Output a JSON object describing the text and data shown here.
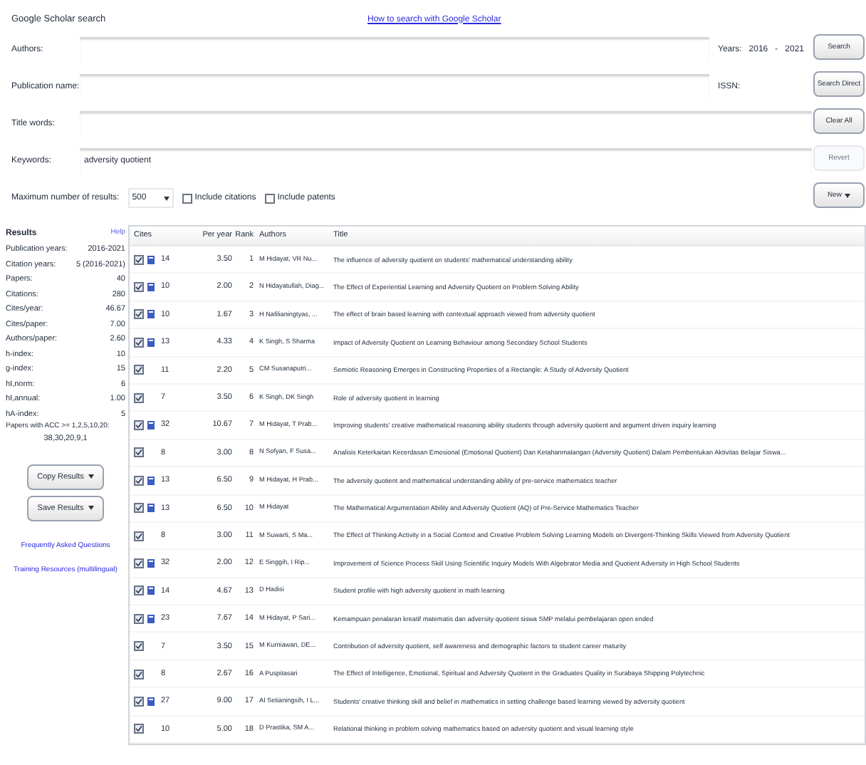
{
  "search": {
    "title": "Google Scholar search",
    "help_link": "How to search with Google Scholar",
    "fields": [
      {
        "label": "Authors:"
      },
      {
        "label": "Publication name:"
      },
      {
        "label": "Title words:"
      },
      {
        "label": "Keywords:",
        "value": "adversity quotient"
      }
    ],
    "years_label": "Years:",
    "year_from": "2016",
    "year_sep": "-",
    "year_to": "2021",
    "issn_label": "ISSN:",
    "max_results_label": "Maximum number of results:",
    "max_results": "500",
    "options": [
      {
        "label": "Include citations",
        "checked": false
      },
      {
        "label": "Include patents",
        "checked": false
      }
    ],
    "buttons": [
      {
        "label": "Search",
        "disabled": false
      },
      {
        "label": "Search Direct",
        "disabled": false
      },
      {
        "label": "Clear All",
        "disabled": false
      },
      {
        "label": "Revert",
        "disabled": true
      },
      {
        "label": "New",
        "disabled": false
      }
    ]
  },
  "results": {
    "title": "Results",
    "help": "Help",
    "metrics": [
      {
        "label": "Publication years:",
        "value": "2016-2021"
      },
      {
        "label": "Citation years:",
        "value": "5 (2016-2021)"
      },
      {
        "label": "Papers:",
        "value": "40"
      },
      {
        "label": "Citations:",
        "value": "280"
      },
      {
        "label": "Cites/year:",
        "value": "46.67"
      },
      {
        "label": "Cites/paper:",
        "value": "7.00"
      },
      {
        "label": "Authors/paper:",
        "value": "2.60"
      },
      {
        "label": "h-index:",
        "value": "10"
      },
      {
        "label": "g-index:",
        "value": "15"
      },
      {
        "label": "hI,norm:",
        "value": "6"
      },
      {
        "label": "hI,annual:",
        "value": "1.00"
      },
      {
        "label": "hA-index:",
        "value": "5"
      }
    ],
    "acc_label": "Papers with ACC >= 1,2,5,10,20:",
    "acc_value": "38,30,20,9,1",
    "actions": [
      "Copy Results",
      "Save Results"
    ],
    "links": [
      "Frequently Asked Questions",
      "Training Resources (multilingual)"
    ]
  },
  "table": {
    "columns": [
      "Cites",
      "Per year",
      "Rank",
      "Authors",
      "Title"
    ],
    "rows": [
      {
        "checked": true,
        "h_core": true,
        "cites": "14",
        "per_year": "3.50",
        "rank": "1",
        "authors": "M Hidayat, VR Nu...",
        "title": "The influence of adversity quotient on students' mathematical understanding ability"
      },
      {
        "checked": true,
        "h_core": true,
        "cites": "10",
        "per_year": "2.00",
        "rank": "2",
        "authors": "N Hidayatullah, Diag...",
        "title": "The Effect of Experiential Learning and Adversity Quotient on Problem Solving Ability"
      },
      {
        "checked": true,
        "h_core": true,
        "cites": "10",
        "per_year": "1.67",
        "rank": "3",
        "authors": "H Nafilianingtyas, ...",
        "title": "The effect of brain based learning with contextual approach viewed from adversity quotient"
      },
      {
        "checked": true,
        "h_core": true,
        "cites": "13",
        "per_year": "4.33",
        "rank": "4",
        "authors": "K Singh, S Sharma",
        "title": "Impact of Adversity Quotient on Learning Behaviour among Secondary School Students"
      },
      {
        "checked": true,
        "h_core": false,
        "cites": "11",
        "per_year": "2.20",
        "rank": "5",
        "authors": "CM Susanaputri...",
        "title": "Semiotic Reasoning Emerges in Constructing Properties of a Rectangle: A Study of Adversity Quotient"
      },
      {
        "checked": true,
        "h_core": false,
        "cites": "7",
        "per_year": "3.50",
        "rank": "6",
        "authors": "K Singh, DK Singh",
        "title": "Role of adversity quotient in learning"
      },
      {
        "checked": true,
        "h_core": true,
        "cites": "32",
        "per_year": "10.67",
        "rank": "7",
        "authors": "M Hidayat, T Prab...",
        "title": "Improving students' creative mathematical reasoning ability students through adversity quotient and argument driven inquiry learning"
      },
      {
        "checked": true,
        "h_core": false,
        "cites": "8",
        "per_year": "3.00",
        "rank": "8",
        "authors": "N Sofyan, F Susa...",
        "title": "Analisis Keterkaitan Kecerdasan Emosional (Emotional Quotient) Dan Ketahanmalangan (Adversity Quotient) Dalam Pembentukan Aktivitas Belajar Siswa..."
      },
      {
        "checked": true,
        "h_core": true,
        "cites": "13",
        "per_year": "6.50",
        "rank": "9",
        "authors": "M Hidayat, H Prab...",
        "title": "The adversity quotient and mathematical understanding ability of pre-service mathematics teacher"
      },
      {
        "checked": true,
        "h_core": true,
        "cites": "13",
        "per_year": "6.50",
        "rank": "10",
        "authors": "M Hidayat",
        "title": "The Mathematical Argumentation Ability and Adversity Quotient (AQ) of Pre-Service Mathematics Teacher"
      },
      {
        "checked": true,
        "h_core": false,
        "cites": "8",
        "per_year": "3.00",
        "rank": "11",
        "authors": "M Suwarti, S Ma...",
        "title": "The Effect of Thinking Activity in a Social Context and Creative Problem Solving Learning Models on Divergent-Thinking Skills Viewed from Adversity Quotient"
      },
      {
        "checked": true,
        "h_core": true,
        "cites": "32",
        "per_year": "2.00",
        "rank": "12",
        "authors": "E Singgih, I Rip...",
        "title": "Improvement of Science Process Skill Using Scientific Inquiry Models With Algebrator Media and Quotient Adversity in High School Students"
      },
      {
        "checked": true,
        "h_core": true,
        "cites": "14",
        "per_year": "4.67",
        "rank": "13",
        "authors": "D Hadisi",
        "title": "Student profile with high adversity quotient in math learning"
      },
      {
        "checked": true,
        "h_core": true,
        "cites": "23",
        "per_year": "7.67",
        "rank": "14",
        "authors": "M Hidayat, P Sari...",
        "title": "Kemampuan penalaran kreatif matematis dan adversity quotient siswa SMP melalui pembelajaran open ended"
      },
      {
        "checked": true,
        "h_core": false,
        "cites": "7",
        "per_year": "3.50",
        "rank": "15",
        "authors": "M Kurniawan, DE...",
        "title": "Contribution of adversity quotient, self awareness and demographic factors to student career maturity"
      },
      {
        "checked": true,
        "h_core": false,
        "cites": "8",
        "per_year": "2.67",
        "rank": "16",
        "authors": "A Puspitasari",
        "title": "The Effect of Intelligence, Emotional, Spiritual and Adversity Quotient in the Graduates Quality in Surabaya Shipping Polytechnic"
      },
      {
        "checked": true,
        "h_core": true,
        "cites": "27",
        "per_year": "9.00",
        "rank": "17",
        "authors": "AI Setianingsih, I L...",
        "title": "Students' creative thinking skill and belief in mathematics in setting challenge based learning viewed by adversity quotient"
      },
      {
        "checked": true,
        "h_core": false,
        "cites": "10",
        "per_year": "5.00",
        "rank": "18",
        "authors": "D Prastika, SM A...",
        "title": "Relational thinking in problem solving mathematics based on adversity quotient and visual learning style"
      }
    ]
  }
}
